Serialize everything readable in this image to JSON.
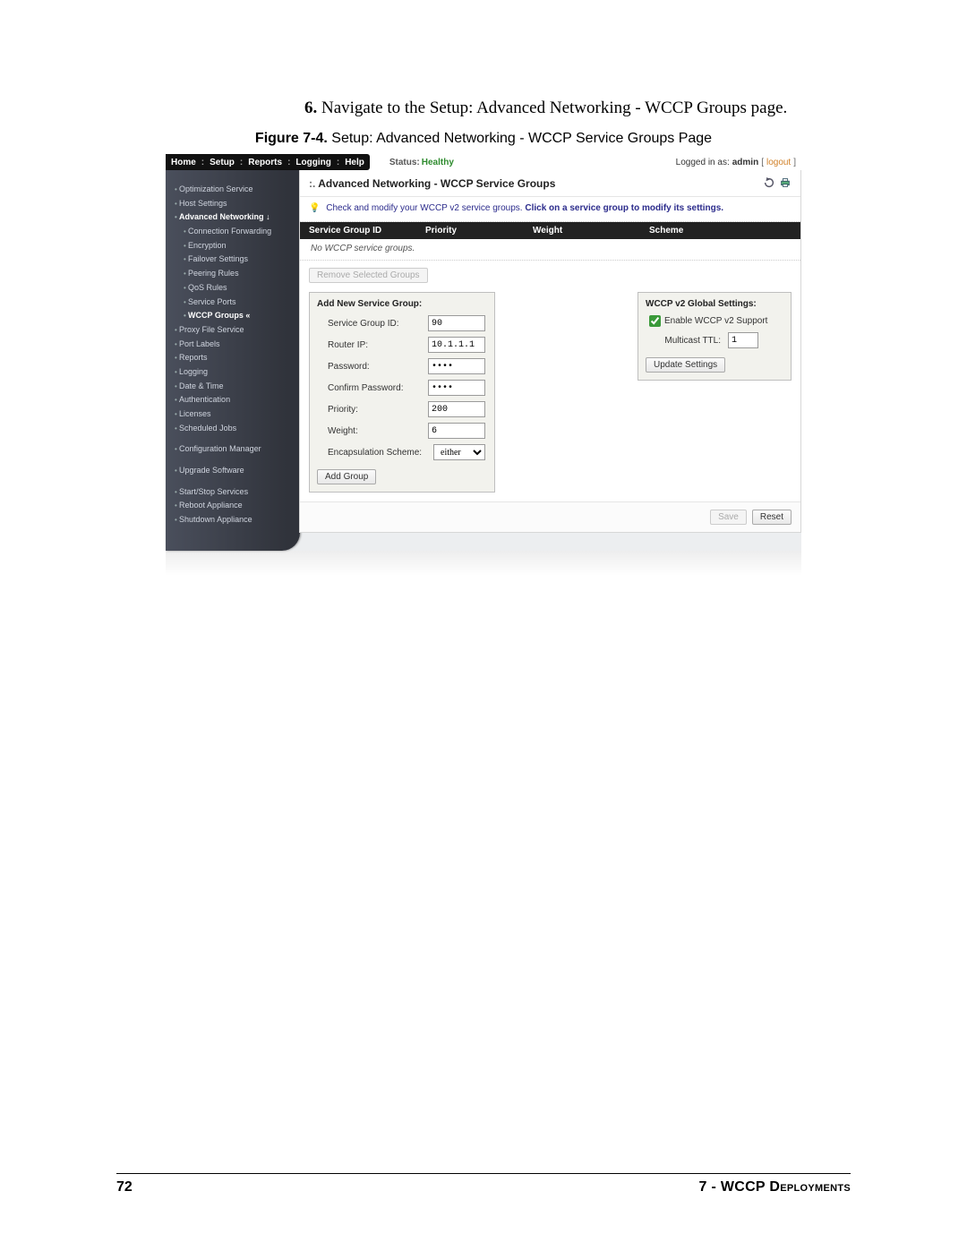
{
  "doc": {
    "step_number": "6.",
    "step_text": "Navigate to the Setup: Advanced Networking - WCCP Groups page.",
    "fig_label": "Figure 7-4.",
    "fig_text": "Setup: Advanced Networking - WCCP Service Groups Page",
    "page_num": "72",
    "chapter": "7 - WCCP Deployments"
  },
  "nav": {
    "tabs": [
      "Home",
      "Setup",
      "Reports",
      "Logging",
      "Help"
    ],
    "status_label": "Status:",
    "status_value": "Healthy",
    "login_prefix": "Logged in as:",
    "login_user": "admin",
    "logout": "logout"
  },
  "sidebar": {
    "top": [
      {
        "label": "Optimization Service"
      },
      {
        "label": "Host Settings"
      },
      {
        "label": "Advanced Networking",
        "bold": true,
        "arrow": "down"
      },
      {
        "label": "Connection Forwarding",
        "sub": true
      },
      {
        "label": "Encryption",
        "sub": true
      },
      {
        "label": "Failover Settings",
        "sub": true
      },
      {
        "label": "Peering Rules",
        "sub": true
      },
      {
        "label": "QoS Rules",
        "sub": true
      },
      {
        "label": "Service Ports",
        "sub": true
      },
      {
        "label": "WCCP Groups",
        "sub": true,
        "cur": true,
        "arrow": "cur"
      },
      {
        "label": "Proxy File Service"
      },
      {
        "label": "Port Labels"
      },
      {
        "label": "Reports"
      },
      {
        "label": "Logging"
      },
      {
        "label": "Date & Time"
      },
      {
        "label": "Authentication"
      },
      {
        "label": "Licenses"
      },
      {
        "label": "Scheduled Jobs"
      }
    ],
    "mid": [
      {
        "label": "Configuration Manager"
      }
    ],
    "mid2": [
      {
        "label": "Upgrade Software"
      }
    ],
    "bottom": [
      {
        "label": "Start/Stop Services"
      },
      {
        "label": "Reboot Appliance"
      },
      {
        "label": "Shutdown Appliance"
      }
    ]
  },
  "main": {
    "title": "Advanced Networking - WCCP Service Groups",
    "hint_prefix": "Check and modify your WCCP v2 service groups. ",
    "hint_bold": "Click on a service group to modify its settings.",
    "grid_cols": [
      "Service Group ID",
      "Priority",
      "Weight",
      "Scheme"
    ],
    "grid_empty": "No WCCP service groups.",
    "remove_btn": "Remove Selected Groups",
    "add_panel": {
      "title": "Add New Service Group:",
      "fields": {
        "sgid_label": "Service Group ID:",
        "sgid_value": "90",
        "router_label": "Router IP:",
        "router_value": "10.1.1.1",
        "pw_label": "Password:",
        "pw_value": "pass",
        "cpw_label": "Confirm Password:",
        "cpw_value": "pass",
        "prio_label": "Priority:",
        "prio_value": "200",
        "weight_label": "Weight:",
        "weight_value": "6",
        "encap_label": "Encapsulation Scheme:",
        "encap_value": "either"
      },
      "add_btn": "Add Group"
    },
    "global_panel": {
      "title": "WCCP v2 Global Settings:",
      "enable_label": "Enable WCCP v2 Support",
      "ttl_label": "Multicast TTL:",
      "ttl_value": "1",
      "update_btn": "Update Settings"
    },
    "save_btn": "Save",
    "reset_btn": "Reset"
  }
}
